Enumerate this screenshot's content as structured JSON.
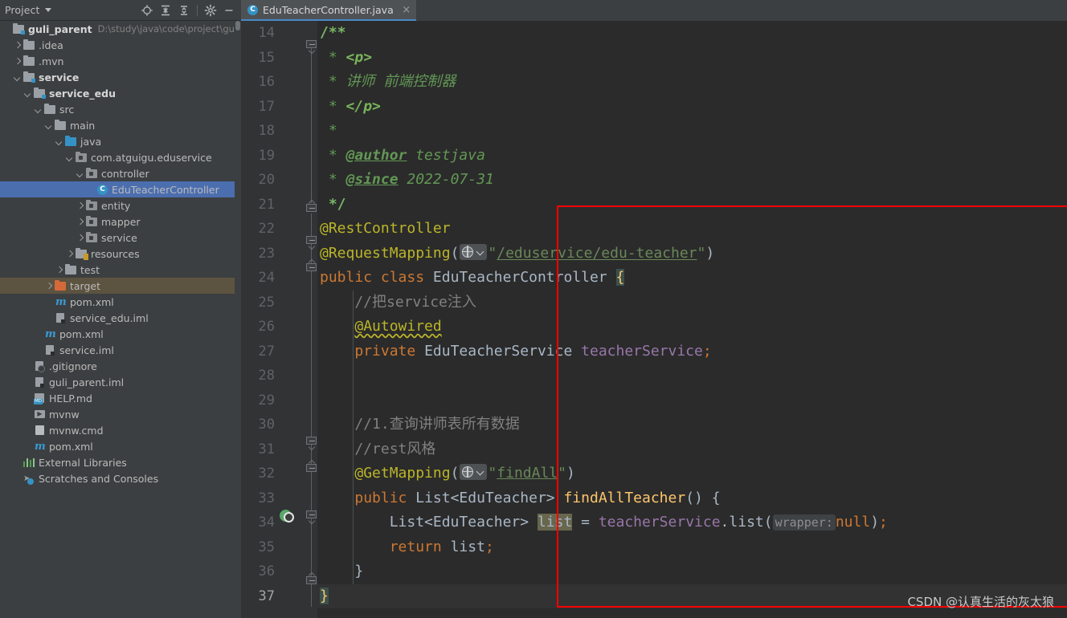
{
  "project_panel": {
    "title": "Project",
    "toolbar": [
      {
        "name": "locate-icon",
        "tooltip": "Select Opened File"
      },
      {
        "name": "expand-all-icon",
        "tooltip": "Expand All"
      },
      {
        "name": "collapse-all-icon",
        "tooltip": "Collapse All"
      },
      {
        "name": "gear-icon",
        "tooltip": "Settings"
      },
      {
        "name": "minimize-icon",
        "tooltip": "Hide"
      }
    ],
    "tree": [
      {
        "label": "guli_parent",
        "path": "D:\\study\\java\\code\\project\\guli_par",
        "icon": "module-folder-icon",
        "indent": 0,
        "arrow": "none",
        "bold": true,
        "state": "normal"
      },
      {
        "label": ".idea",
        "icon": "folder-icon",
        "indent": 1,
        "arrow": "closed",
        "bold": false,
        "state": "normal"
      },
      {
        "label": ".mvn",
        "icon": "folder-icon",
        "indent": 1,
        "arrow": "closed",
        "bold": false,
        "state": "normal"
      },
      {
        "label": "service",
        "icon": "module-folder-icon",
        "indent": 1,
        "arrow": "open",
        "bold": true,
        "state": "normal"
      },
      {
        "label": "service_edu",
        "icon": "module-folder-icon",
        "indent": 2,
        "arrow": "open",
        "bold": true,
        "state": "normal"
      },
      {
        "label": "src",
        "icon": "folder-icon",
        "indent": 3,
        "arrow": "open",
        "bold": false,
        "state": "normal"
      },
      {
        "label": "main",
        "icon": "folder-icon",
        "indent": 4,
        "arrow": "open",
        "bold": false,
        "state": "normal"
      },
      {
        "label": "java",
        "icon": "source-folder-icon",
        "indent": 5,
        "arrow": "open",
        "bold": false,
        "state": "normal"
      },
      {
        "label": "com.atguigu.eduservice",
        "icon": "package-icon",
        "indent": 6,
        "arrow": "open",
        "bold": false,
        "state": "normal"
      },
      {
        "label": "controller",
        "icon": "package-icon",
        "indent": 7,
        "arrow": "open",
        "bold": false,
        "state": "normal"
      },
      {
        "label": "EduTeacherController",
        "icon": "java-class-icon",
        "indent": 8,
        "arrow": "none",
        "bold": false,
        "state": "selected"
      },
      {
        "label": "entity",
        "icon": "package-icon",
        "indent": 7,
        "arrow": "closed",
        "bold": false,
        "state": "normal"
      },
      {
        "label": "mapper",
        "icon": "package-icon",
        "indent": 7,
        "arrow": "closed",
        "bold": false,
        "state": "normal"
      },
      {
        "label": "service",
        "icon": "package-icon",
        "indent": 7,
        "arrow": "closed",
        "bold": false,
        "state": "normal"
      },
      {
        "label": "resources",
        "icon": "resources-folder-icon",
        "indent": 6,
        "arrow": "closed",
        "bold": false,
        "state": "normal"
      },
      {
        "label": "test",
        "icon": "folder-icon",
        "indent": 5,
        "arrow": "closed",
        "bold": false,
        "state": "normal"
      },
      {
        "label": "target",
        "icon": "target-folder-icon",
        "indent": 4,
        "arrow": "closed",
        "bold": false,
        "state": "hovered"
      },
      {
        "label": "pom.xml",
        "icon": "maven-icon",
        "indent": 4,
        "arrow": "none",
        "bold": false,
        "state": "normal"
      },
      {
        "label": "service_edu.iml",
        "icon": "iml-icon",
        "indent": 4,
        "arrow": "none",
        "bold": false,
        "state": "normal"
      },
      {
        "label": "pom.xml",
        "icon": "maven-icon",
        "indent": 3,
        "arrow": "none",
        "bold": false,
        "state": "normal"
      },
      {
        "label": "service.iml",
        "icon": "iml-icon",
        "indent": 3,
        "arrow": "none",
        "bold": false,
        "state": "normal"
      },
      {
        "label": ".gitignore",
        "icon": "gitignore-icon",
        "indent": 2,
        "arrow": "none",
        "bold": false,
        "state": "normal"
      },
      {
        "label": "guli_parent.iml",
        "icon": "iml-icon",
        "indent": 2,
        "arrow": "none",
        "bold": false,
        "state": "normal"
      },
      {
        "label": "HELP.md",
        "icon": "markdown-icon",
        "indent": 2,
        "arrow": "none",
        "bold": false,
        "state": "normal"
      },
      {
        "label": "mvnw",
        "icon": "shell-script-icon",
        "indent": 2,
        "arrow": "none",
        "bold": false,
        "state": "normal"
      },
      {
        "label": "mvnw.cmd",
        "icon": "cmd-script-icon",
        "indent": 2,
        "arrow": "none",
        "bold": false,
        "state": "normal"
      },
      {
        "label": "pom.xml",
        "icon": "maven-icon",
        "indent": 2,
        "arrow": "none",
        "bold": false,
        "state": "normal"
      },
      {
        "label": "External Libraries",
        "icon": "libraries-icon",
        "indent": 1,
        "arrow": "none",
        "bold": false,
        "state": "normal"
      },
      {
        "label": "Scratches and Consoles",
        "icon": "scratches-icon",
        "indent": 1,
        "arrow": "none",
        "bold": false,
        "state": "normal"
      }
    ]
  },
  "editor": {
    "tab": {
      "label": "EduTeacherController.java",
      "icon": "java-class-icon",
      "close_label": "×"
    },
    "first_line_number": 14,
    "lines": [
      {
        "n": 14,
        "text": "/**"
      },
      {
        "n": 15,
        "text": " * <p>"
      },
      {
        "n": 16,
        "text": " * 讲师 前端控制器"
      },
      {
        "n": 17,
        "text": " * </p>"
      },
      {
        "n": 18,
        "text": " *"
      },
      {
        "n": 19,
        "text": " * @author testjava"
      },
      {
        "n": 20,
        "text": " * @since 2022-07-31"
      },
      {
        "n": 21,
        "text": " */"
      },
      {
        "n": 22,
        "text": "@RestController"
      },
      {
        "n": 23,
        "text": "@RequestMapping(\"/eduservice/edu-teacher\")"
      },
      {
        "n": 24,
        "text": "public class EduTeacherController {"
      },
      {
        "n": 25,
        "text": "    //把service注入"
      },
      {
        "n": 26,
        "text": "    @Autowired"
      },
      {
        "n": 27,
        "text": "    private EduTeacherService teacherService;"
      },
      {
        "n": 28,
        "text": ""
      },
      {
        "n": 29,
        "text": ""
      },
      {
        "n": 30,
        "text": "    //1.查询讲师表所有数据"
      },
      {
        "n": 31,
        "text": "    //rest风格"
      },
      {
        "n": 32,
        "text": "    @GetMapping(\"findAll\")"
      },
      {
        "n": 33,
        "text": "    public List<EduTeacher> findAllTeacher() {"
      },
      {
        "n": 34,
        "text": "        List<EduTeacher> list = teacherService.list(null);"
      },
      {
        "n": 35,
        "text": "        return list;"
      },
      {
        "n": 36,
        "text": "    }"
      },
      {
        "n": 37,
        "text": "}"
      }
    ],
    "inlay_hints": [
      {
        "line": 34,
        "text": "wrapper:"
      }
    ],
    "gutter_icons": [
      {
        "line": 33,
        "name": "run-endpoint-icon"
      }
    ],
    "current_line": 37,
    "annotation_box_color": "#ff0000"
  },
  "watermark": "CSDN @认真生活的灰太狼",
  "colors": {
    "panel_bg": "#3c3f41",
    "editor_bg": "#2b2b2b",
    "gutter_bg": "#313335",
    "selection": "#4b6eaf",
    "hover": "#5c5340",
    "annotation": "#ff0000",
    "keyword": "#cc7832",
    "annotation_token": "#bbb529",
    "string": "#6a8759",
    "field": "#9876aa",
    "method": "#ffc66d",
    "comment": "#808080",
    "javadoc": "#629755"
  }
}
